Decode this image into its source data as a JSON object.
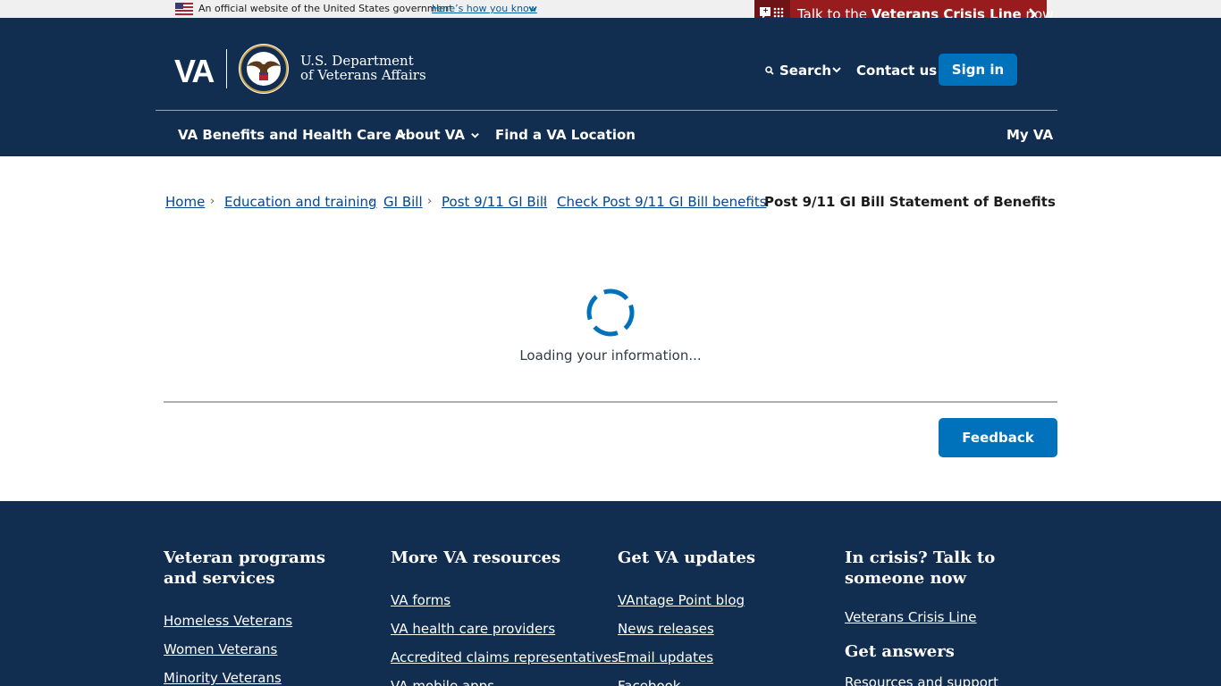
{
  "gov_banner": {
    "official_text": "An official website of the United States government",
    "how_link": "Here’s how you know"
  },
  "crisis": {
    "prefix": "Talk to the ",
    "bold": "Veterans Crisis Line",
    "suffix": " now"
  },
  "header": {
    "logo_text": "VA",
    "dept_line1": "U.S. Department",
    "dept_line2": "of Veterans Affairs",
    "search_label": "Search",
    "contact_label": "Contact us",
    "signin_label": "Sign in"
  },
  "nav": {
    "benefits": "VA Benefits and Health Care",
    "about": "About VA",
    "find": "Find a VA Location",
    "myva": "My VA"
  },
  "breadcrumb": {
    "items": [
      "Home",
      "Education and training",
      "GI Bill",
      "Post 9/11 GI Bill",
      "Check Post 9/11 GI Bill benefits"
    ],
    "separator": "›",
    "current": "Post 9/11 GI Bill Statement of Benefits"
  },
  "main": {
    "loading_text": "Loading your information...",
    "feedback_label": "Feedback"
  },
  "footer": {
    "col1": {
      "title": "Veteran programs and services",
      "links": [
        "Homeless Veterans",
        "Women Veterans",
        "Minority Veterans"
      ]
    },
    "col2": {
      "title": "More VA resources",
      "links": [
        "VA forms",
        "VA health care providers",
        "Accredited claims representatives",
        "VA mobile apps"
      ]
    },
    "col3": {
      "title": "Get VA updates",
      "links": [
        "VAntage Point blog",
        "News releases",
        "Email updates",
        "Facebook"
      ]
    },
    "col4": {
      "title": "In crisis? Talk to someone now",
      "links": [
        "Veterans Crisis Line"
      ],
      "title2": "Get answers",
      "links2": [
        "Resources and support"
      ]
    }
  },
  "colors": {
    "header_bg": "#112e51",
    "primary_button": "#0071bb",
    "crisis_red": "#981b1e",
    "link": "#004795"
  }
}
